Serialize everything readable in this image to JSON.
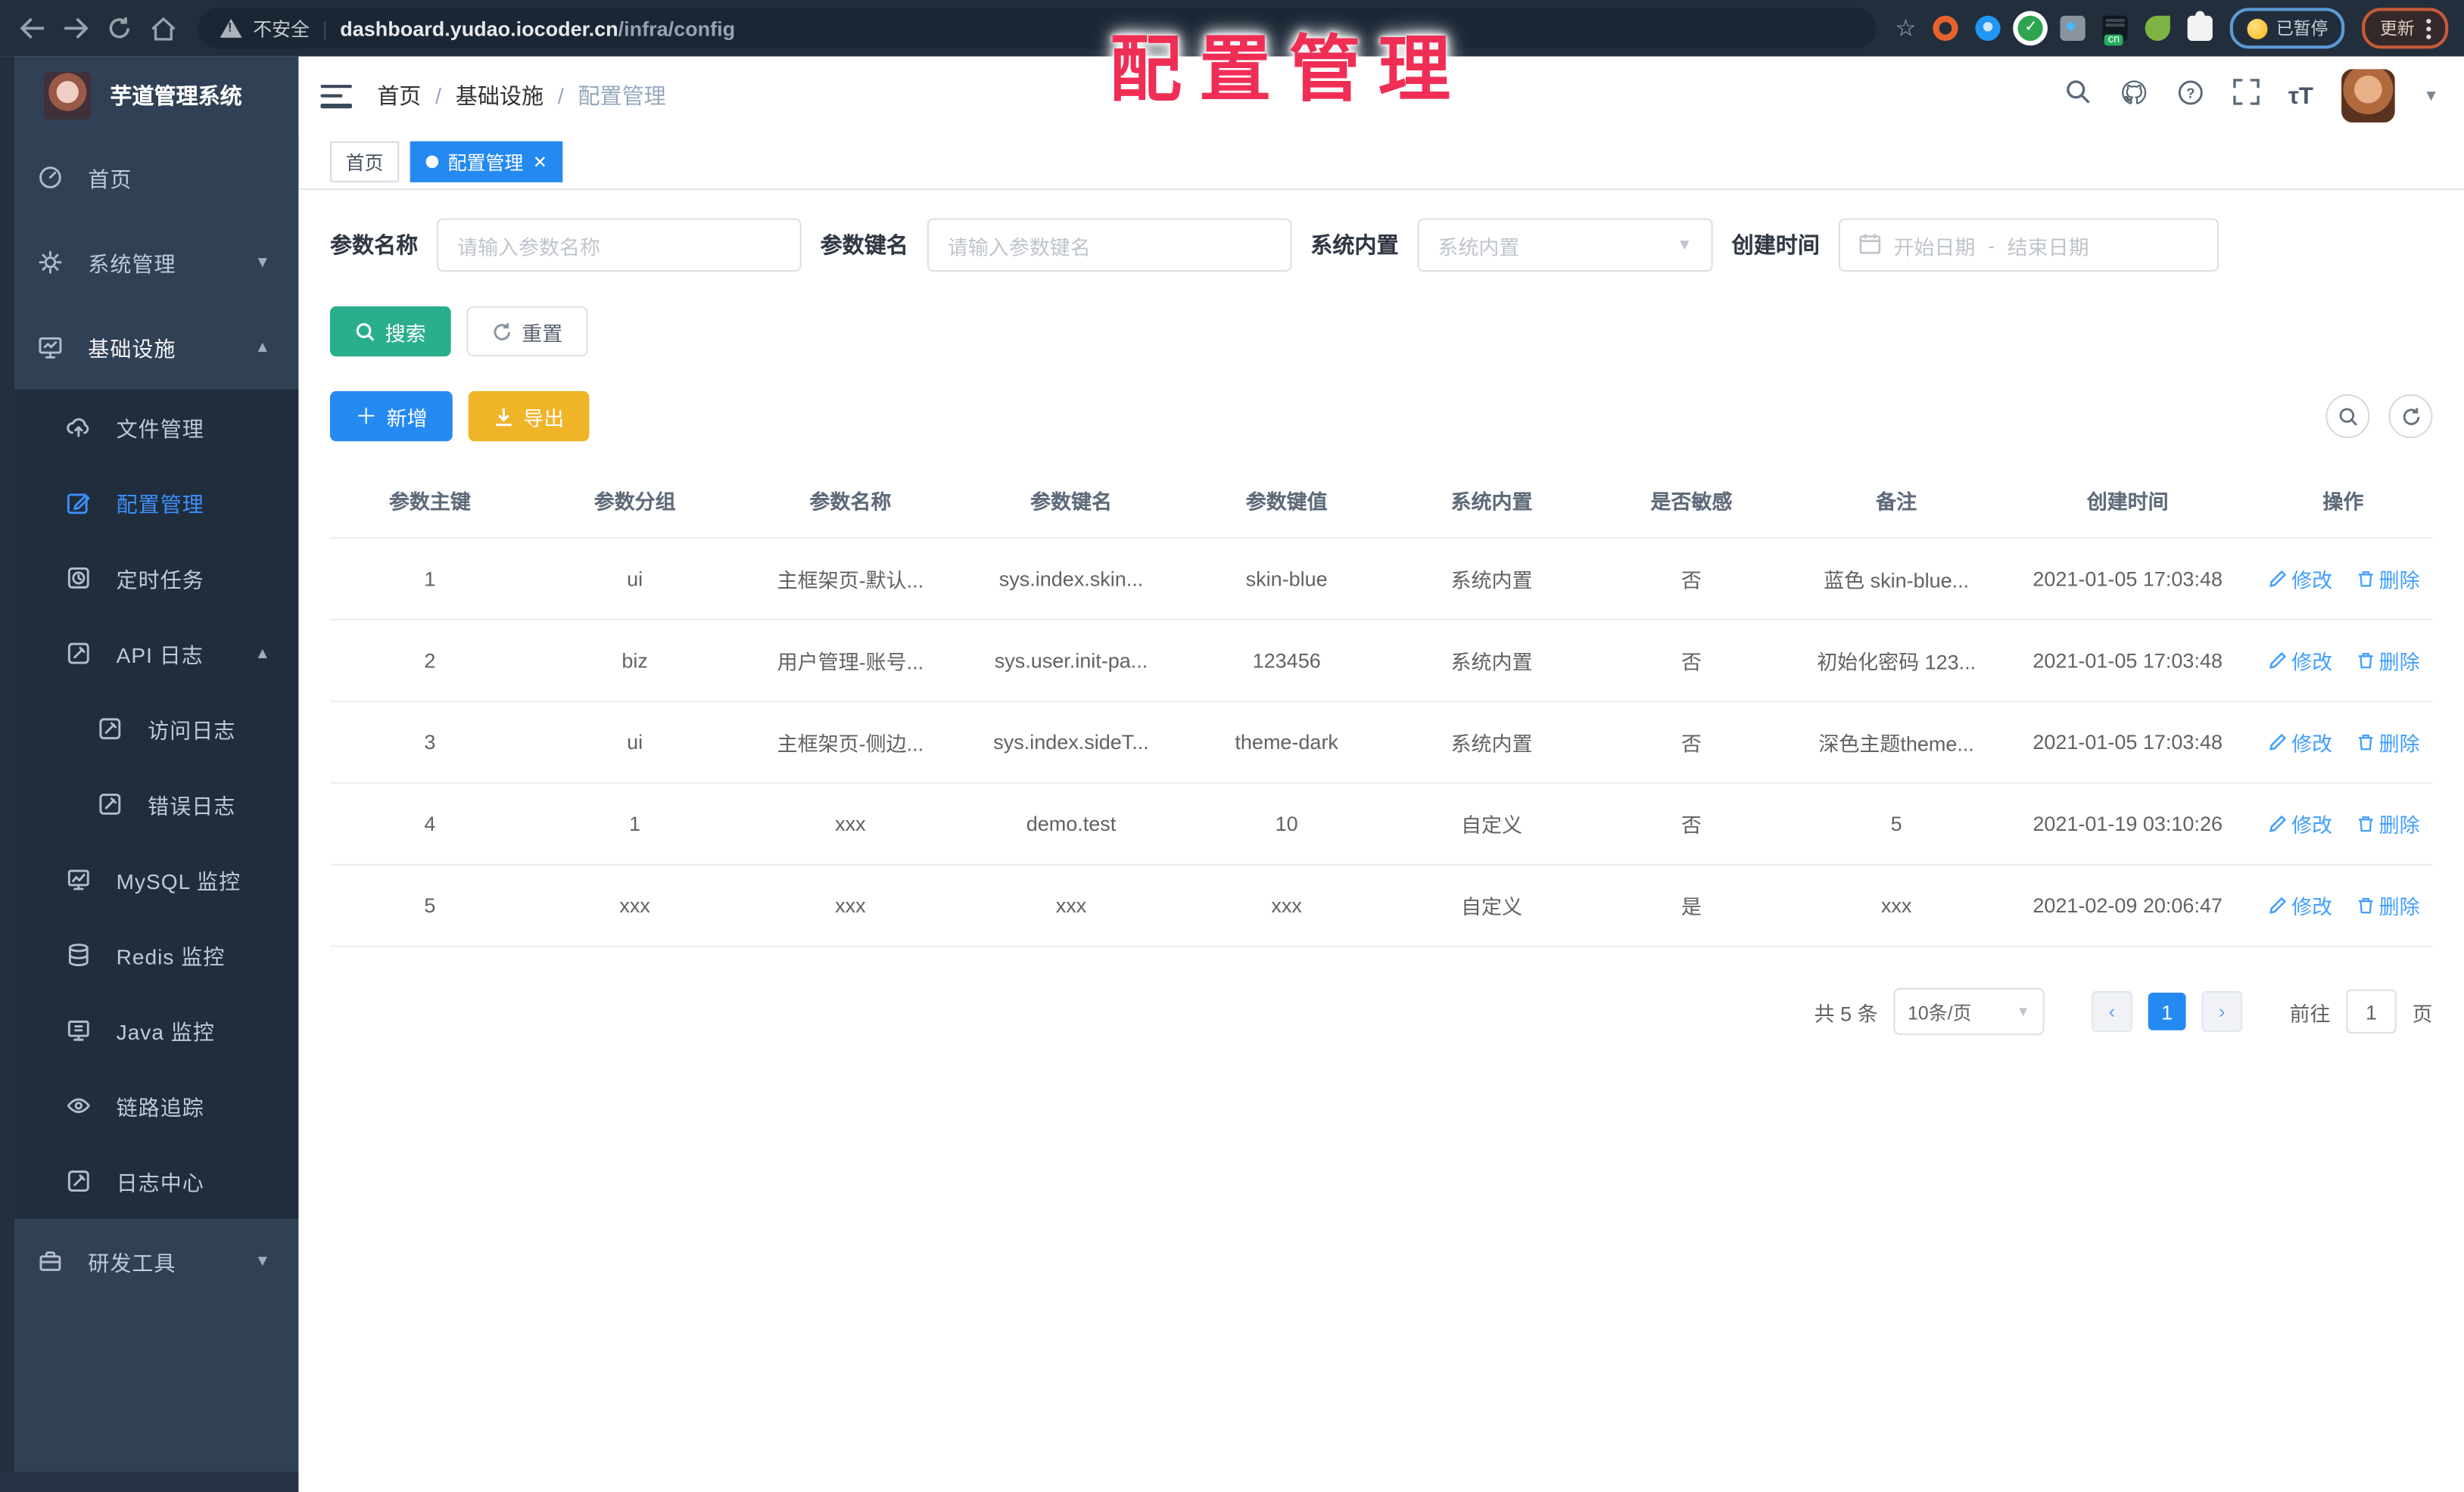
{
  "browser": {
    "security_label": "不安全",
    "url_domain": "dashboard.yudao.iocoder.cn",
    "url_path": "/infra/config",
    "paused_label": "已暂停",
    "update_label": "更新"
  },
  "overlay": {
    "watermark": "配置管理"
  },
  "app": {
    "title": "芋道管理系统"
  },
  "sidebar": {
    "items": [
      {
        "label": "首页"
      },
      {
        "label": "系统管理"
      },
      {
        "label": "基础设施"
      },
      {
        "label": "文件管理"
      },
      {
        "label": "配置管理"
      },
      {
        "label": "定时任务"
      },
      {
        "label": "API 日志"
      },
      {
        "label": "访问日志"
      },
      {
        "label": "错误日志"
      },
      {
        "label": "MySQL 监控"
      },
      {
        "label": "Redis 监控"
      },
      {
        "label": "Java 监控"
      },
      {
        "label": "链路追踪"
      },
      {
        "label": "日志中心"
      },
      {
        "label": "研发工具"
      }
    ]
  },
  "breadcrumb": {
    "items": [
      "首页",
      "基础设施",
      "配置管理"
    ],
    "separator": "/"
  },
  "tabs": [
    {
      "label": "首页"
    },
    {
      "label": "配置管理"
    }
  ],
  "filters": {
    "name_label": "参数名称",
    "name_placeholder": "请输入参数名称",
    "key_label": "参数键名",
    "key_placeholder": "请输入参数键名",
    "type_label": "系统内置",
    "type_placeholder": "系统内置",
    "date_label": "创建时间",
    "date_start_placeholder": "开始日期",
    "date_separator": "-",
    "date_end_placeholder": "结束日期",
    "search_label": "搜索",
    "reset_label": "重置"
  },
  "toolbar": {
    "add_label": "新增",
    "export_label": "导出"
  },
  "table": {
    "columns": [
      "参数主键",
      "参数分组",
      "参数名称",
      "参数键名",
      "参数键值",
      "系统内置",
      "是否敏感",
      "备注",
      "创建时间",
      "操作"
    ],
    "rows": [
      [
        "1",
        "ui",
        "主框架页-默认...",
        "sys.index.skin...",
        "skin-blue",
        "系统内置",
        "否",
        "蓝色 skin-blue...",
        "2021-01-05 17:03:48"
      ],
      [
        "2",
        "biz",
        "用户管理-账号...",
        "sys.user.init-pa...",
        "123456",
        "系统内置",
        "否",
        "初始化密码 123...",
        "2021-01-05 17:03:48"
      ],
      [
        "3",
        "ui",
        "主框架页-侧边...",
        "sys.index.sideT...",
        "theme-dark",
        "系统内置",
        "否",
        "深色主题theme...",
        "2021-01-05 17:03:48"
      ],
      [
        "4",
        "1",
        "xxx",
        "demo.test",
        "10",
        "自定义",
        "否",
        "5",
        "2021-01-19 03:10:26"
      ],
      [
        "5",
        "xxx",
        "xxx",
        "xxx",
        "xxx",
        "自定义",
        "是",
        "xxx",
        "2021-02-09 20:06:47"
      ]
    ],
    "edit_label": "修改",
    "delete_label": "删除"
  },
  "pagination": {
    "total": "共 5 条",
    "page_size": "10条/页",
    "current_page": "1",
    "goto_label": "前往",
    "goto_value": "1",
    "page_suffix": "页"
  },
  "colors": {
    "accent_blue": "#2589f2",
    "sidebar_bg": "#304156",
    "submenu_bg": "#1f2d3d",
    "search_green": "#2aaf8c",
    "export_yellow": "#f0b428",
    "watermark_red": "#f02e55"
  }
}
